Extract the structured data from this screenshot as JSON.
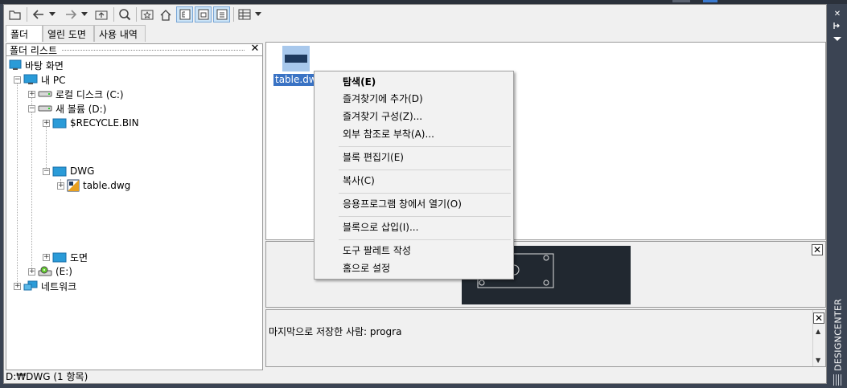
{
  "toolbar": {
    "buttons": [
      "load-icon",
      "back-icon",
      "back-dropdown-icon",
      "forward-icon",
      "forward-dropdown-icon",
      "up-icon",
      "search-icon",
      "favorites-icon",
      "home-icon",
      "tree-toggle-icon",
      "preview-toggle-icon",
      "description-toggle-icon",
      "views-icon",
      "views-dropdown-icon"
    ]
  },
  "tabs": [
    {
      "label": "폴더"
    },
    {
      "label": "열린 도면"
    },
    {
      "label": "사용 내역"
    }
  ],
  "folder_list": {
    "title": "폴더 리스트",
    "close": "✕",
    "tree": [
      {
        "label": "바탕 화면"
      },
      {
        "label": "내 PC"
      },
      {
        "label": "로컬 디스크 (C:)"
      },
      {
        "label": "새 볼륨 (D:)"
      },
      {
        "label": "$RECYCLE.BIN"
      },
      {
        "label": "DWG"
      },
      {
        "label": "table.dwg"
      },
      {
        "label": "도면"
      },
      {
        "label": "(E:)"
      },
      {
        "label": "네트워크"
      }
    ]
  },
  "status": "D:₩DWG (1 항목)",
  "content": {
    "file_label": "table.dw"
  },
  "context_menu": {
    "items": [
      {
        "label": "탐색(E)"
      },
      {
        "label": "즐겨찾기에 추가(D)"
      },
      {
        "label": "즐겨찾기 구성(Z)..."
      },
      {
        "label": "외부 참조로 부착(A)..."
      },
      {
        "label": "블록 편집기(E)"
      },
      {
        "label": "복사(C)"
      },
      {
        "label": "응용프로그램 창에서 열기(O)"
      },
      {
        "label": "블록으로 삽입(I)..."
      },
      {
        "label": "도구 팔레트 작성"
      },
      {
        "label": "홈으로 설정"
      }
    ]
  },
  "description": {
    "text": "마지막으로 저장한 사람: progra"
  },
  "sidebar": {
    "title": "DESIGNCENTER",
    "close": "✕"
  },
  "colors": {
    "selection": "#3a73c4",
    "dark_background": "#3b4453",
    "preview_background": "#212830"
  }
}
